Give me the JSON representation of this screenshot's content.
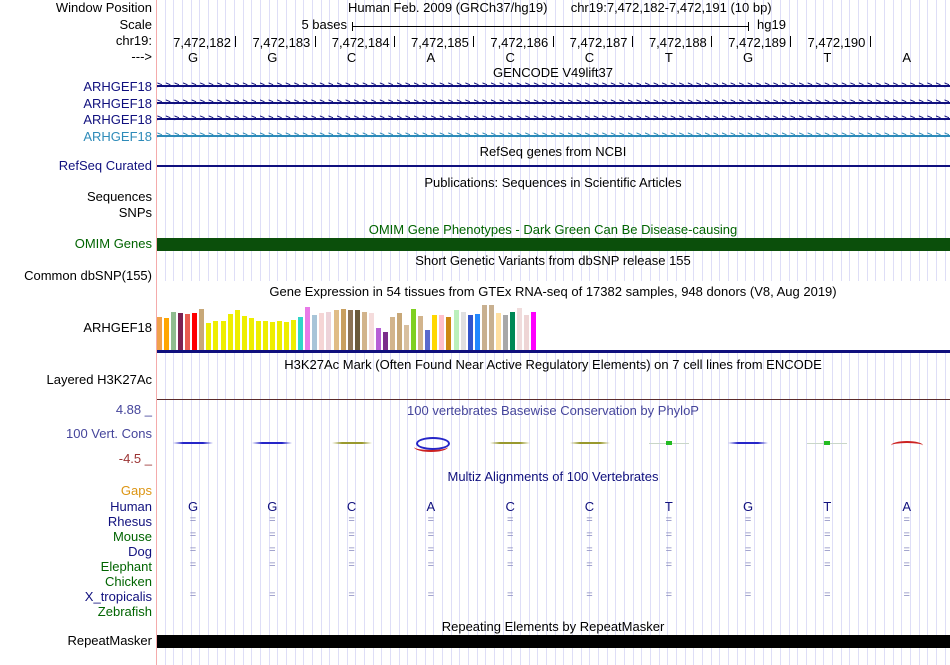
{
  "header": {
    "window_position_label": "Window Position",
    "assembly_title": "Human Feb. 2009 (GRCh37/hg19)",
    "position_title": "chr19:7,472,182-7,472,191 (10 bp)",
    "scale_label": "Scale",
    "scale_value": "5 bases",
    "genome": "hg19",
    "chrom_label": "chr19:",
    "strand_label": "--->",
    "coordinates": [
      "7,472,182",
      "7,472,183",
      "7,472,184",
      "7,472,185",
      "7,472,186",
      "7,472,187",
      "7,472,188",
      "7,472,189",
      "7,472,190"
    ],
    "bases": [
      "G",
      "G",
      "C",
      "A",
      "C",
      "C",
      "T",
      "G",
      "T",
      "A"
    ]
  },
  "tracks": {
    "gencode": {
      "title": "GENCODE V49lift37",
      "transcripts": [
        {
          "label": "ARHGEF18",
          "color": "#10107e"
        },
        {
          "label": "ARHGEF18",
          "color": "#10107e"
        },
        {
          "label": "ARHGEF18",
          "color": "#10107e"
        },
        {
          "label": "ARHGEF18",
          "color": "#2e8bb9"
        }
      ]
    },
    "refseq": {
      "title": "RefSeq genes from NCBI",
      "label": "RefSeq Curated"
    },
    "publications": {
      "title": "Publications: Sequences in Scientific Articles",
      "rows": [
        "Sequences",
        "SNPs"
      ]
    },
    "omim": {
      "title": "OMIM Gene Phenotypes - Dark Green Can Be Disease-causing",
      "label": "OMIM Genes",
      "bar_color": "#0b4f0b"
    },
    "dbsnp": {
      "title": "Short Genetic Variants from dbSNP release 155",
      "label": "Common dbSNP(155)"
    },
    "gtex": {
      "title": "Gene Expression in 54 tissues from GTEx RNA-seq of 17382 samples, 948 donors (V8, Aug 2019)",
      "label": "ARHGEF18",
      "chart": {
        "type": "bar",
        "n_tissues": 54,
        "heights": [
          33,
          32,
          38,
          37,
          36,
          37,
          41,
          27,
          29,
          29,
          36,
          40,
          34,
          32,
          29,
          29,
          28,
          29,
          28,
          30,
          33,
          43,
          35,
          37,
          38,
          40,
          41,
          40,
          40,
          38,
          37,
          22,
          18,
          33,
          37,
          25,
          41,
          34,
          20,
          35,
          35,
          33,
          40,
          38,
          35,
          36,
          45,
          45,
          37,
          35,
          38,
          42,
          35,
          38
        ],
        "colors": [
          "#f0a04b",
          "#ffa500",
          "#8fbc8f",
          "#7b2252",
          "#e85c50",
          "#ff0000",
          "#c8a878",
          "#eeee00",
          "#eeee00",
          "#eeee00",
          "#eeee00",
          "#eeee00",
          "#eeee00",
          "#eeee00",
          "#eeee00",
          "#eeee00",
          "#eeee00",
          "#eeee00",
          "#eeee00",
          "#eeee00",
          "#30d5c8",
          "#e87ae8",
          "#a8c4d8",
          "#f5d5d5",
          "#edd3d9",
          "#e0bc86",
          "#c8a060",
          "#8b7355",
          "#6b5b3b",
          "#d2b48c",
          "#f5dcdc",
          "#b75fd6",
          "#7b2d8b",
          "#d2b48c",
          "#c8a878",
          "#d8c0a0",
          "#7fd020",
          "#d2b48c",
          "#5a6acd",
          "#ffd700",
          "#ffc0cb",
          "#cc8811",
          "#bbf0bb",
          "#e0e0e0",
          "#3355cc",
          "#2288ff",
          "#c8b090",
          "#c8b090",
          "#ffdfa0",
          "#a8a8a8",
          "#008855",
          "#f0dcdc",
          "#eed5d5",
          "#ff00ff"
        ],
        "baseline_color": "#10107e"
      }
    },
    "h3k27ac": {
      "title": "H3K27Ac Mark (Often Found Near Active Regulatory Elements) on 7 cell lines from ENCODE",
      "label": "Layered H3K27Ac",
      "baseline_color": "#5a2a2a"
    },
    "phylop": {
      "title": "100 vertebrates Basewise Conservation by PhyloP",
      "label": "100 Vert. Cons",
      "max_label": "4.88 _",
      "min_label": "-4.5 _",
      "marks": [
        "blue",
        "blue",
        "olive",
        "blob",
        "olive",
        "olive",
        "dot",
        "blue",
        "dot",
        "red"
      ]
    },
    "multiz": {
      "title": "Multiz Alignments of 100 Vertebrates",
      "gaps_label": "Gaps",
      "rows": [
        {
          "name": "Human",
          "color": "#10107e",
          "mark": "bases"
        },
        {
          "name": "Rhesus",
          "color": "#10107e",
          "mark": "eq"
        },
        {
          "name": "Mouse",
          "color": "#006400",
          "mark": "eq"
        },
        {
          "name": "Dog",
          "color": "#10107e",
          "mark": "eq"
        },
        {
          "name": "Elephant",
          "color": "#006400",
          "mark": "eq"
        },
        {
          "name": "Chicken",
          "color": "#006400",
          "mark": "none"
        },
        {
          "name": "X_tropicalis",
          "color": "#10107e",
          "mark": "eq"
        },
        {
          "name": "Zebrafish",
          "color": "#006400",
          "mark": "none"
        }
      ]
    },
    "repeatmasker": {
      "title": "Repeating Elements by RepeatMasker",
      "label": "RepeatMasker",
      "bar_color": "#000000"
    }
  },
  "colors": {
    "grid": "#dedef7",
    "left_guide": "#f4abab",
    "phylop_blue": "#2525c8",
    "phylop_olive": "#99992e",
    "phylop_red": "#cc2222",
    "phylop_green": "#22bb22",
    "eq_mark": "#8789bf"
  }
}
